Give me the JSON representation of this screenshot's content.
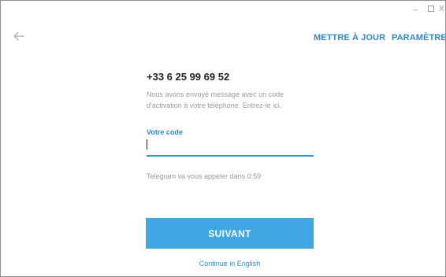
{
  "window": {
    "controls": {
      "minimize_label": "_",
      "maximize_icon": "maximize-icon",
      "close_label": "X"
    }
  },
  "nav": {
    "back_icon": "arrow-left-icon",
    "update_label": "METTRE À JOUR",
    "settings_label": "PARAMÈTRES"
  },
  "login": {
    "phone_number": "+33 6 25 99 69 52",
    "description": "Nous avons envoyé message avec un code d'activation à votre téléphone. Entrez-le ici.",
    "code_label": "Votre code",
    "code_value": "",
    "call_note": "Telegram va vous appeler dans 0:59",
    "next_label": "SUIVANT",
    "language_link": "Continue in English"
  },
  "colors": {
    "accent": "#2e8ac6",
    "button": "#40a7e3",
    "muted_text": "#9a9a9a",
    "input_underline": "#3a95d3"
  }
}
